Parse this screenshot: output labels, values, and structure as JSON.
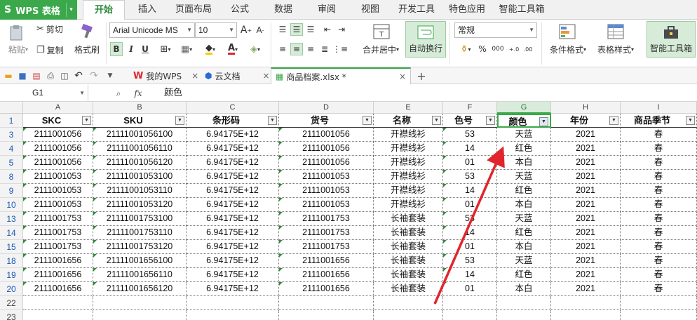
{
  "app": {
    "name": "WPS 表格"
  },
  "menu": {
    "tabs": [
      "开始",
      "插入",
      "页面布局",
      "公式",
      "数据",
      "审阅",
      "视图",
      "开发工具",
      "特色应用",
      "智能工具箱"
    ],
    "active": "开始"
  },
  "ribbon": {
    "paste": "粘贴",
    "cut": "剪切",
    "copy": "复制",
    "format_painter": "格式刷",
    "font_name": "Arial Unicode MS",
    "font_size": "10",
    "merge_center": "合并居中",
    "wrap_text": "自动换行",
    "number_format": "常规",
    "conditional_format": "条件格式",
    "table_style": "表格样式",
    "smart_toolbox": "智能工具箱",
    "bold": "B",
    "italic": "I",
    "underline": "U",
    "percent": "%",
    "comma": "000"
  },
  "doc_tabs": [
    {
      "label": "我的WPS",
      "icon": "wps-logo-icon"
    },
    {
      "label": "云文档",
      "icon": "cloud-doc-icon"
    },
    {
      "label": "商品档案.xlsx *",
      "icon": "spreadsheet-file-icon",
      "active": true
    }
  ],
  "formula_bar": {
    "cell_ref": "G1",
    "fx": "fx",
    "content": "颜色"
  },
  "columns": [
    "A",
    "B",
    "C",
    "D",
    "E",
    "F",
    "G",
    "H",
    "I"
  ],
  "selected_column": "G",
  "header_row": {
    "row": "1",
    "cells": [
      "SKC",
      "SKU",
      "条形码",
      "货号",
      "名称",
      "色号",
      "颜色",
      "年份",
      "商品季节"
    ]
  },
  "rows": [
    {
      "row": "3",
      "cells": [
        "2111001056",
        "21111001056100",
        "6.94175E+12",
        "2111001056",
        "开襟线衫",
        "53",
        "天蓝",
        "2021",
        "春"
      ]
    },
    {
      "row": "4",
      "cells": [
        "2111001056",
        "21111001056110",
        "6.94175E+12",
        "2111001056",
        "开襟线衫",
        "14",
        "红色",
        "2021",
        "春"
      ]
    },
    {
      "row": "5",
      "cells": [
        "2111001056",
        "21111001056120",
        "6.94175E+12",
        "2111001056",
        "开襟线衫",
        "01",
        "本白",
        "2021",
        "春"
      ]
    },
    {
      "row": "8",
      "cells": [
        "2111001053",
        "21111001053100",
        "6.94175E+12",
        "2111001053",
        "开襟线衫",
        "53",
        "天蓝",
        "2021",
        "春"
      ]
    },
    {
      "row": "9",
      "cells": [
        "2111001053",
        "21111001053110",
        "6.94175E+12",
        "2111001053",
        "开襟线衫",
        "14",
        "红色",
        "2021",
        "春"
      ]
    },
    {
      "row": "10",
      "cells": [
        "2111001053",
        "21111001053120",
        "6.94175E+12",
        "2111001053",
        "开襟线衫",
        "01",
        "本白",
        "2021",
        "春"
      ]
    },
    {
      "row": "13",
      "cells": [
        "2111001753",
        "21111001753100",
        "6.94175E+12",
        "2111001753",
        "长袖套装",
        "53",
        "天蓝",
        "2021",
        "春"
      ]
    },
    {
      "row": "14",
      "cells": [
        "2111001753",
        "21111001753110",
        "6.94175E+12",
        "2111001753",
        "长袖套装",
        "14",
        "红色",
        "2021",
        "春"
      ]
    },
    {
      "row": "15",
      "cells": [
        "2111001753",
        "21111001753120",
        "6.94175E+12",
        "2111001753",
        "长袖套装",
        "01",
        "本白",
        "2021",
        "春"
      ]
    },
    {
      "row": "18",
      "cells": [
        "2111001656",
        "21111001656100",
        "6.94175E+12",
        "2111001656",
        "长袖套装",
        "53",
        "天蓝",
        "2021",
        "春"
      ]
    },
    {
      "row": "19",
      "cells": [
        "2111001656",
        "21111001656110",
        "6.94175E+12",
        "2111001656",
        "长袖套装",
        "14",
        "红色",
        "2021",
        "春"
      ]
    },
    {
      "row": "20",
      "cells": [
        "2111001656",
        "21111001656120",
        "6.94175E+12",
        "2111001656",
        "长袖套装",
        "01",
        "本白",
        "2021",
        "春"
      ]
    },
    {
      "row": "22",
      "cells": [
        "",
        "",
        "",
        "",
        "",
        "",
        "",
        "",
        ""
      ]
    },
    {
      "row": "23",
      "cells": [
        "",
        "",
        "",
        "",
        "",
        "",
        "",
        "",
        ""
      ]
    }
  ],
  "colors": {
    "accent": "#3aa84b",
    "annotation_arrow": "#e0262c",
    "row_number": "#1a58b5"
  }
}
